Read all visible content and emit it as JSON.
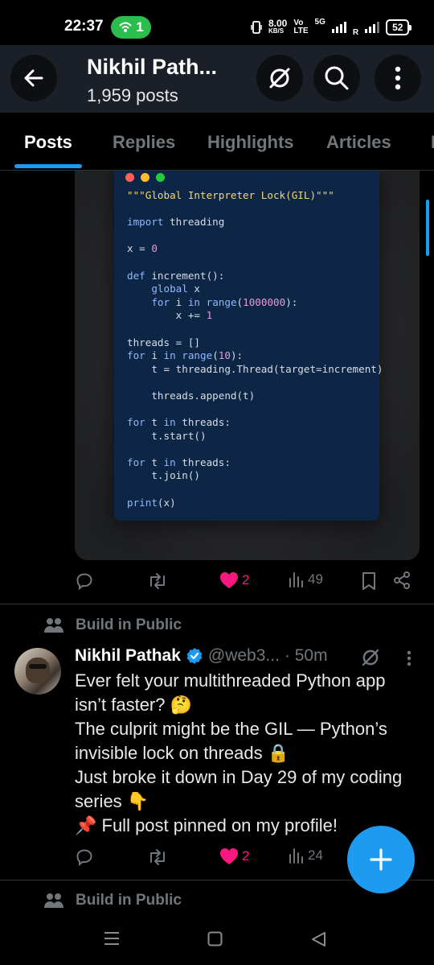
{
  "status_bar": {
    "time": "22:37",
    "hotspot_count": "1",
    "speed_value": "8.00",
    "speed_unit": "KB/S",
    "volte_top": "Vo",
    "volte_bottom": "LTE",
    "network": "5G",
    "roaming": "R",
    "battery": "52"
  },
  "header": {
    "profile_name": "Nikhil Path...",
    "post_count": "1,959 posts",
    "icons": [
      "back-arrow-icon",
      "grok-icon",
      "search-icon",
      "more-vertical-icon"
    ]
  },
  "tabs": [
    {
      "label": "Posts",
      "active": true
    },
    {
      "label": "Replies",
      "active": false
    },
    {
      "label": "Highlights",
      "active": false
    },
    {
      "label": "Articles",
      "active": false
    },
    {
      "label": "M",
      "active": false
    }
  ],
  "code_image": {
    "lines": [
      "\"\"\"Global Interpreter Lock(GIL)\"\"\"",
      "",
      "import threading",
      "",
      "x = 0",
      "",
      "def increment():",
      "    global x",
      "    for i in range(1000000):",
      "        x += 1",
      "",
      "threads = []",
      "for i in range(10):",
      "    t = threading.Thread(target=increment)",
      "",
      "    threads.append(t)",
      "",
      "for t in threads:",
      "    t.start()",
      "",
      "for t in threads:",
      "    t.join()",
      "",
      "print(x)"
    ]
  },
  "post1_actions": {
    "likes": "2",
    "views": "49"
  },
  "post2": {
    "community": "Build in Public",
    "author_name": "Nikhil Pathak",
    "handle": "@web3...",
    "time": "· 50m",
    "text_lines": [
      "Ever felt your multithreaded Python app",
      "isn’t faster? 🤔",
      "The culprit might be the GIL — Python’s",
      "invisible lock on threads 🔒",
      "Just broke it down in Day 29 of my coding",
      "series 👇",
      "📌 Full post pinned on my profile!"
    ],
    "likes": "2",
    "views": "24"
  },
  "post3": {
    "community": "Build in Public"
  },
  "colors": {
    "accent": "#1d9bf0",
    "like": "#f91880",
    "muted": "#71767b",
    "code_bg": "#0d2646"
  }
}
